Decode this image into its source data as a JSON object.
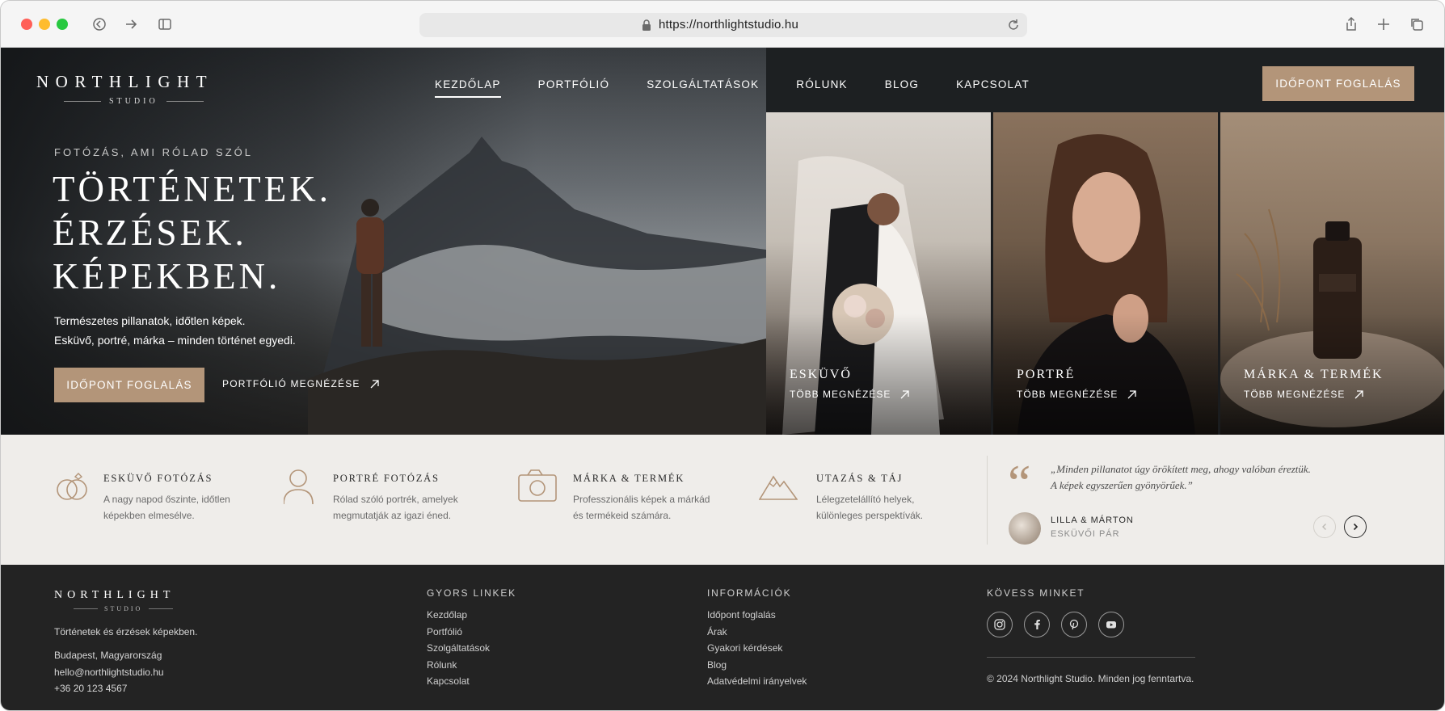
{
  "browser": {
    "url": "https://northlightstudio.hu"
  },
  "brand": {
    "name": "NORTHLIGHT",
    "sub": "STUDIO",
    "accent": "#b39579"
  },
  "nav": {
    "items": [
      "KEZDŐLAP",
      "PORTFÓLIÓ",
      "SZOLGÁLTATÁSOK",
      "RÓLUNK",
      "BLOG",
      "KAPCSOLAT"
    ],
    "active": "KEZDŐLAP",
    "cta": "IDŐPONT FOGLALÁS"
  },
  "hero": {
    "eyebrow": "FOTÓZÁS, AMI RÓLAD SZÓL",
    "headline": [
      "TÖRTÉNETEK.",
      "ÉRZÉSEK.",
      "KÉPEKBEN."
    ],
    "sub": [
      "Természetes pillanatok, időtlen képek.",
      "Esküvő, portré, márka – minden történet egyedi."
    ],
    "cta": "IDŐPONT FOGLALÁS",
    "link": "PORTFÓLIÓ MEGNÉZÉSE"
  },
  "panels": [
    {
      "title": "ESKÜVŐ",
      "link": "TÖBB MEGNÉZÉSE"
    },
    {
      "title": "PORTRÉ",
      "link": "TÖBB MEGNÉZÉSE"
    },
    {
      "title": "MÁRKA & TERMÉK",
      "link": "TÖBB MEGNÉZÉSE"
    }
  ],
  "services": [
    {
      "icon": "rings-icon",
      "title": "ESKÜVŐ FOTÓZÁS",
      "text": [
        "A nagy napod őszinte, időtlen",
        "képekben elmesélve."
      ]
    },
    {
      "icon": "person-icon",
      "title": "PORTRÉ FOTÓZÁS",
      "text": [
        "Rólad szóló portrék, amelyek",
        "megmutatják az igazi éned."
      ]
    },
    {
      "icon": "camera-icon",
      "title": "MÁRKA & TERMÉK",
      "text": [
        "Professzionális képek a márkád",
        "és termékeid számára."
      ]
    },
    {
      "icon": "mountain-icon",
      "title": "UTAZÁS & TÁJ",
      "text": [
        "Lélegzetelállító helyek,",
        "különleges perspektívák."
      ]
    }
  ],
  "testimonial": {
    "quote": [
      "„Minden pillanatot úgy örökített meg, ahogy valóban éreztük.",
      "A képek egyszerűen gyönyörűek.”"
    ],
    "author": "LILLA & MÁRTON",
    "role": "ESKÜVŐI PÁR"
  },
  "footer": {
    "tagline": "Történetek és érzések képekben.",
    "contact": [
      "Budapest, Magyarország",
      "hello@northlightstudio.hu",
      "+36 20 123 4567"
    ],
    "quick_links": {
      "title": "GYORS LINKEK",
      "items": [
        "Kezdőlap",
        "Portfólió",
        "Szolgáltatások",
        "Rólunk",
        "Kapcsolat"
      ]
    },
    "info": {
      "title": "INFORMÁCIÓK",
      "items": [
        "Időpont foglalás",
        "Árak",
        "Gyakori kérdések",
        "Blog",
        "Adatvédelmi irányelvek"
      ]
    },
    "follow": {
      "title": "KÖVESS MINKET",
      "icons": [
        "instagram-icon",
        "facebook-icon",
        "pinterest-icon",
        "youtube-icon"
      ]
    },
    "copyright": "© 2024 Northlight Studio. Minden jog fenntartva."
  }
}
